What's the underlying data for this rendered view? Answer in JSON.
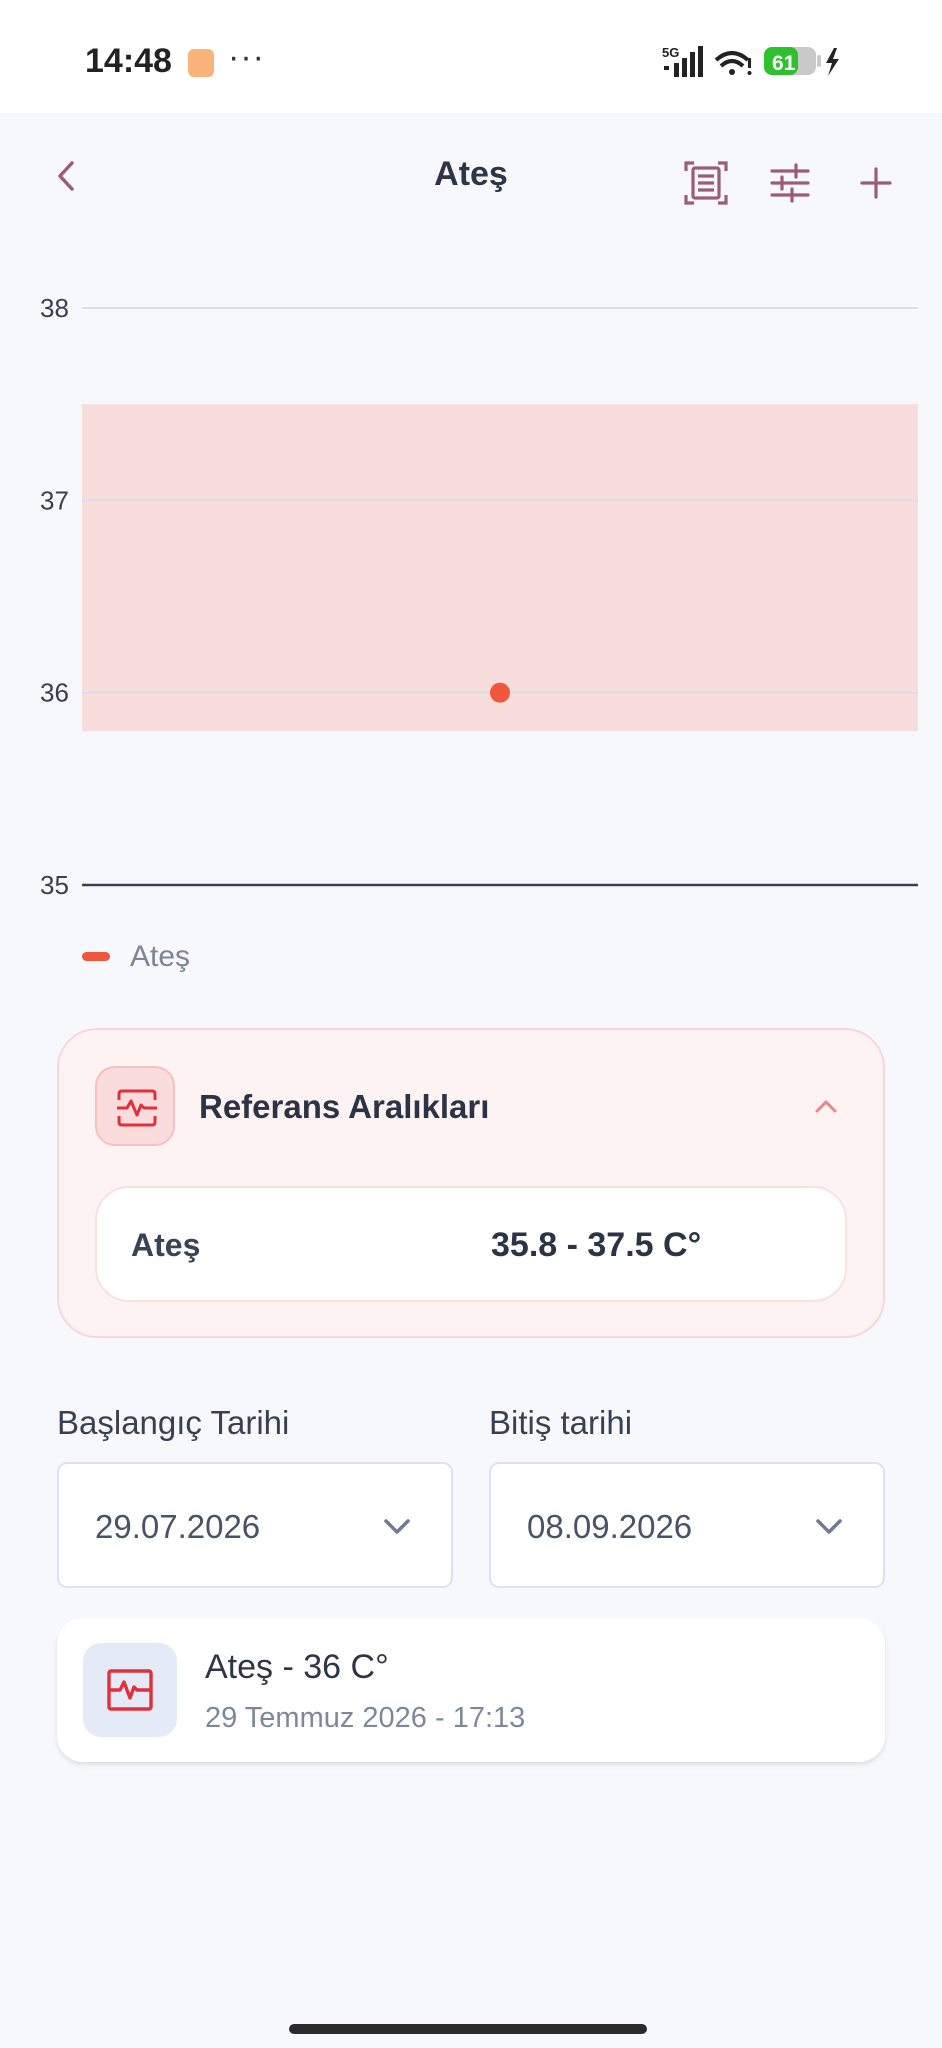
{
  "status_bar": {
    "time": "14:48",
    "dots": "···",
    "network": "5G",
    "battery": "61"
  },
  "header": {
    "title": "Ateş",
    "icons": [
      "back-icon",
      "scan-icon",
      "filter-icon",
      "plus-icon"
    ]
  },
  "chart_data": {
    "type": "scatter",
    "title": "",
    "xlabel": "",
    "ylabel": "",
    "ylim": [
      35,
      38
    ],
    "yticks": [
      38,
      37,
      36,
      35
    ],
    "grid": true,
    "reference_band": {
      "min": 35.8,
      "max": 37.5,
      "color": "#f7dedd"
    },
    "series": [
      {
        "name": "Ateş",
        "color": "#f0573c",
        "x": [
          "29.07.2026 17:13"
        ],
        "values": [
          36
        ]
      }
    ],
    "legend": "bottom-left"
  },
  "reference": {
    "title": "Referans Aralıkları",
    "rows": [
      {
        "name": "Ateş",
        "range": "35.8 - 37.5 C°"
      }
    ]
  },
  "dates": {
    "start_label": "Başlangıç Tarihi",
    "start_value": "29.07.2026",
    "end_label": "Bitiş tarihi",
    "end_value": "08.09.2026"
  },
  "records": [
    {
      "title": "Ateş - 36 C°",
      "subtitle": "29 Temmuz 2026 - 17:13"
    }
  ],
  "colors": {
    "accent": "#9a5c78",
    "point": "#f0573c",
    "band": "#f7dedd",
    "record_icon": "#e0303c"
  }
}
